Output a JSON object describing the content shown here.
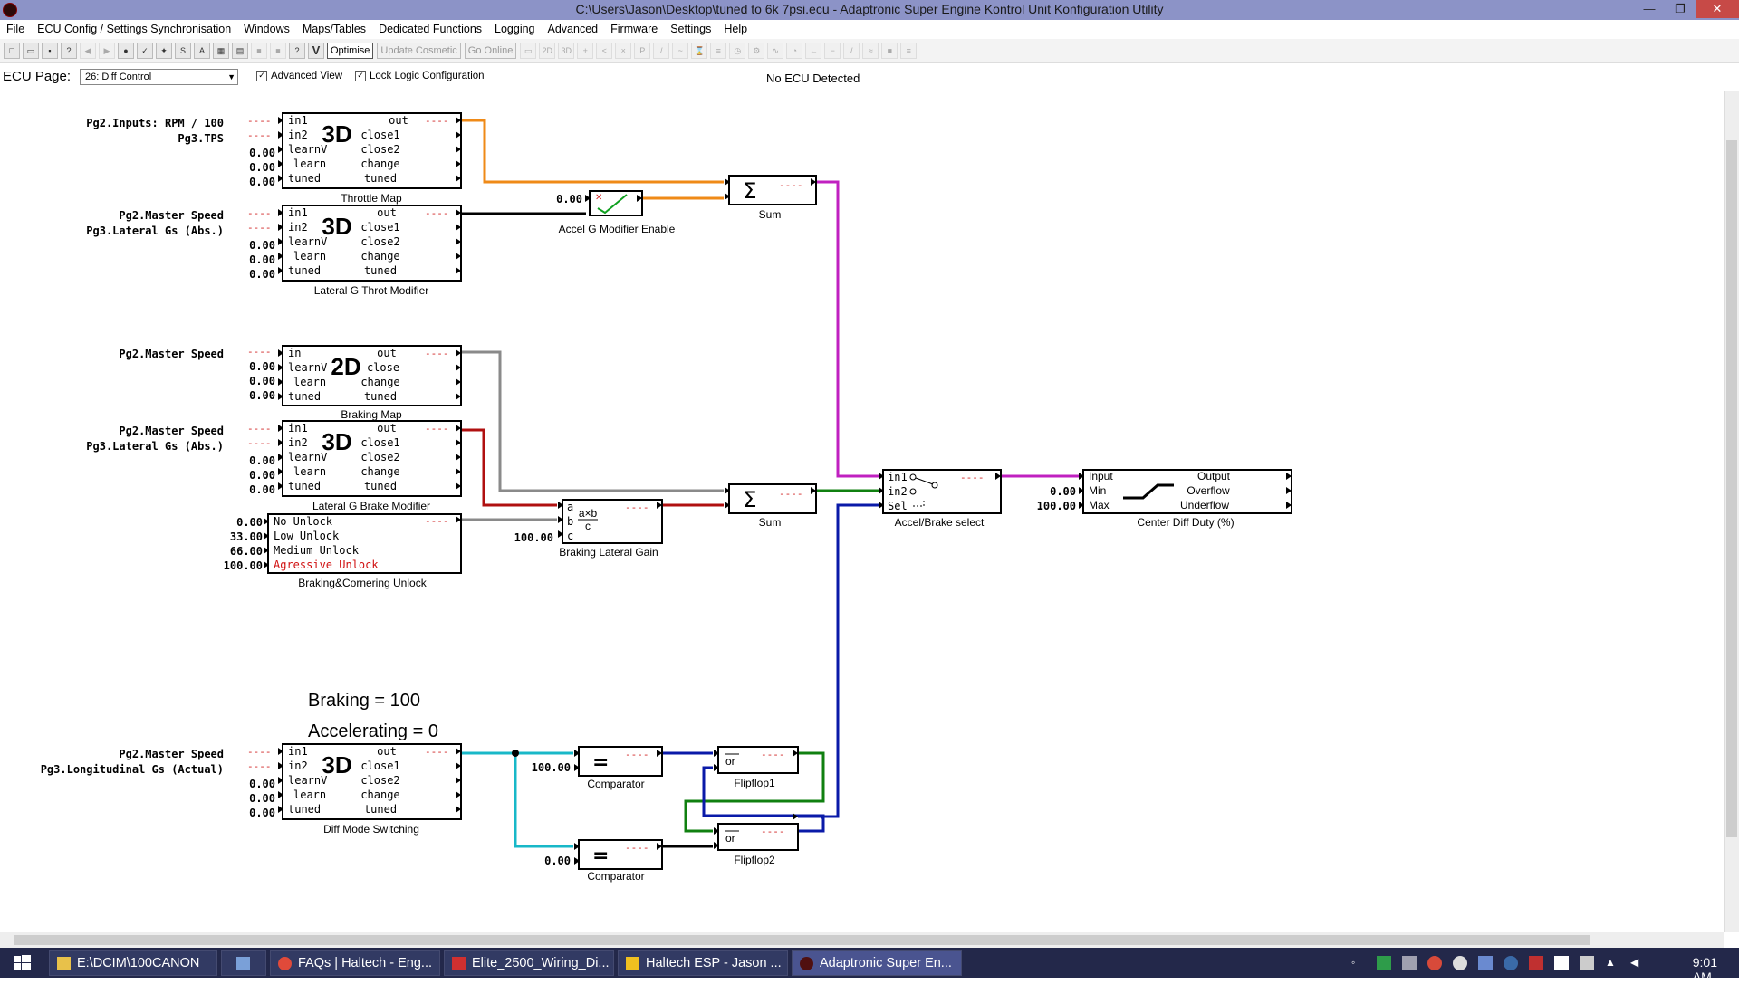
{
  "window": {
    "title": "C:\\Users\\Jason\\Desktop\\tuned to 6k 7psi.ecu  -  Adaptronic Super Engine Kontrol Unit Konfiguration Utility",
    "min": "—",
    "max": "❐",
    "close": "✕"
  },
  "menu": [
    "File",
    "ECU Config / Settings Synchronisation",
    "Windows",
    "Maps/Tables",
    "Dedicated Functions",
    "Logging",
    "Advanced",
    "Firmware",
    "Settings",
    "Help"
  ],
  "toolbar": {
    "optimise": "Optimise",
    "update_cosmetic": "Update Cosmetic",
    "go_online": "Go Online",
    "v": "V"
  },
  "page": {
    "label": "ECU Page:",
    "selected": "26: Diff Control",
    "advanced_view": "Advanced View",
    "lock_logic": "Lock Logic Configuration",
    "status": "No ECU Detected"
  },
  "diagram": {
    "notes": {
      "braking": "Braking = 100",
      "accelerating": "Accelerating = 0"
    },
    "blocks": {
      "throttle_map": {
        "name": "Throttle Map",
        "type": "3D",
        "inputs": [
          "Pg2.Inputs: RPM / 100",
          "Pg3.TPS"
        ],
        "values": [
          "0.00",
          "0.00",
          "0.00"
        ],
        "pins_in": [
          "in1",
          "in2",
          "learnV",
          "learn",
          "tuned"
        ],
        "pins_out": [
          "out",
          "close1",
          "close2",
          "change",
          "tuned"
        ]
      },
      "lateral_g_throt": {
        "name": "Lateral G Throt Modifier",
        "type": "3D",
        "inputs": [
          "Pg2.Master Speed",
          "Pg3.Lateral Gs (Abs.)"
        ],
        "values": [
          "0.00",
          "0.00",
          "0.00"
        ],
        "pins_in": [
          "in1",
          "in2",
          "learnV",
          "learn",
          "tuned"
        ],
        "pins_out": [
          "out",
          "close1",
          "close2",
          "change",
          "tuned"
        ]
      },
      "braking_map": {
        "name": "Braking Map",
        "type": "2D",
        "inputs": [
          "Pg2.Master Speed"
        ],
        "values": [
          "0.00",
          "0.00",
          "0.00"
        ],
        "pins_in": [
          "in",
          "learnV",
          "learn",
          "tuned"
        ],
        "pins_out": [
          "out",
          "close",
          "change",
          "tuned"
        ]
      },
      "lateral_g_brake": {
        "name": "Lateral G Brake Modifier",
        "type": "3D",
        "inputs": [
          "Pg2.Master Speed",
          "Pg3.Lateral Gs (Abs.)"
        ],
        "values": [
          "0.00",
          "0.00",
          "0.00"
        ],
        "pins_in": [
          "in1",
          "in2",
          "learnV",
          "learn",
          "tuned"
        ],
        "pins_out": [
          "out",
          "close1",
          "close2",
          "change",
          "tuned"
        ]
      },
      "unlock": {
        "name": "Braking&Cornering Unlock",
        "values": [
          "0.00",
          "33.00",
          "66.00",
          "100.00"
        ],
        "options": [
          "No Unlock",
          "Low Unlock",
          "Medium Unlock",
          "Agressive Unlock"
        ]
      },
      "diff_mode": {
        "name": "Diff Mode Switching",
        "type": "3D",
        "inputs": [
          "Pg2.Master Speed",
          "Pg3.Longitudinal Gs (Actual)"
        ],
        "values": [
          "0.00",
          "0.00",
          "0.00"
        ],
        "pins_in": [
          "in1",
          "in2",
          "learnV",
          "learn",
          "tuned"
        ],
        "pins_out": [
          "out",
          "close1",
          "close2",
          "change",
          "tuned"
        ]
      },
      "accel_enable": {
        "name": "Accel G Modifier Enable",
        "value": "0.00"
      },
      "sum1": {
        "name": "Sum",
        "symbol": "Σ"
      },
      "sum2": {
        "name": "Sum",
        "symbol": "Σ"
      },
      "braking_gain": {
        "name": "Braking Lateral Gain",
        "pins": [
          "a",
          "b",
          "c"
        ],
        "value": "100.00",
        "formula_top": "a×b",
        "formula_bot": "c"
      },
      "accel_brake": {
        "name": "Accel/Brake select",
        "pins": [
          "in1",
          "in2",
          "Sel"
        ]
      },
      "center_diff": {
        "name": "Center Diff Duty (%)",
        "pins_in": [
          "Input",
          "Min",
          "Max"
        ],
        "pins_out": [
          "Output",
          "Overflow",
          "Underflow"
        ],
        "values": [
          "0.00",
          "100.00"
        ]
      },
      "comparator1": {
        "name": "Comparator",
        "value": "100.00",
        "symbol": "="
      },
      "comparator2": {
        "name": "Comparator",
        "value": "0.00",
        "symbol": "="
      },
      "flipflop1": {
        "name": "Flipflop1",
        "op": "or"
      },
      "flipflop2": {
        "name": "Flipflop2",
        "op": "or"
      }
    },
    "dash": "----"
  },
  "taskbar": {
    "items": [
      "E:\\DCIM\\100CANON",
      "",
      "FAQs | Haltech - Eng...",
      "Elite_2500_Wiring_Di...",
      "Haltech ESP - Jason ...",
      "Adaptronic Super En..."
    ],
    "clock": "9:01 AM"
  },
  "colors": {
    "titlebar": "#8c93c7",
    "taskbar": "#23284a",
    "wire_orange": "#ef8a17",
    "wire_magenta": "#c020c0",
    "wire_gray": "#8a8a8a",
    "wire_red": "#b01010",
    "wire_green": "#108010",
    "wire_blue": "#0a1aa8",
    "wire_cyan": "#18b8c8",
    "wire_black": "#000000"
  }
}
